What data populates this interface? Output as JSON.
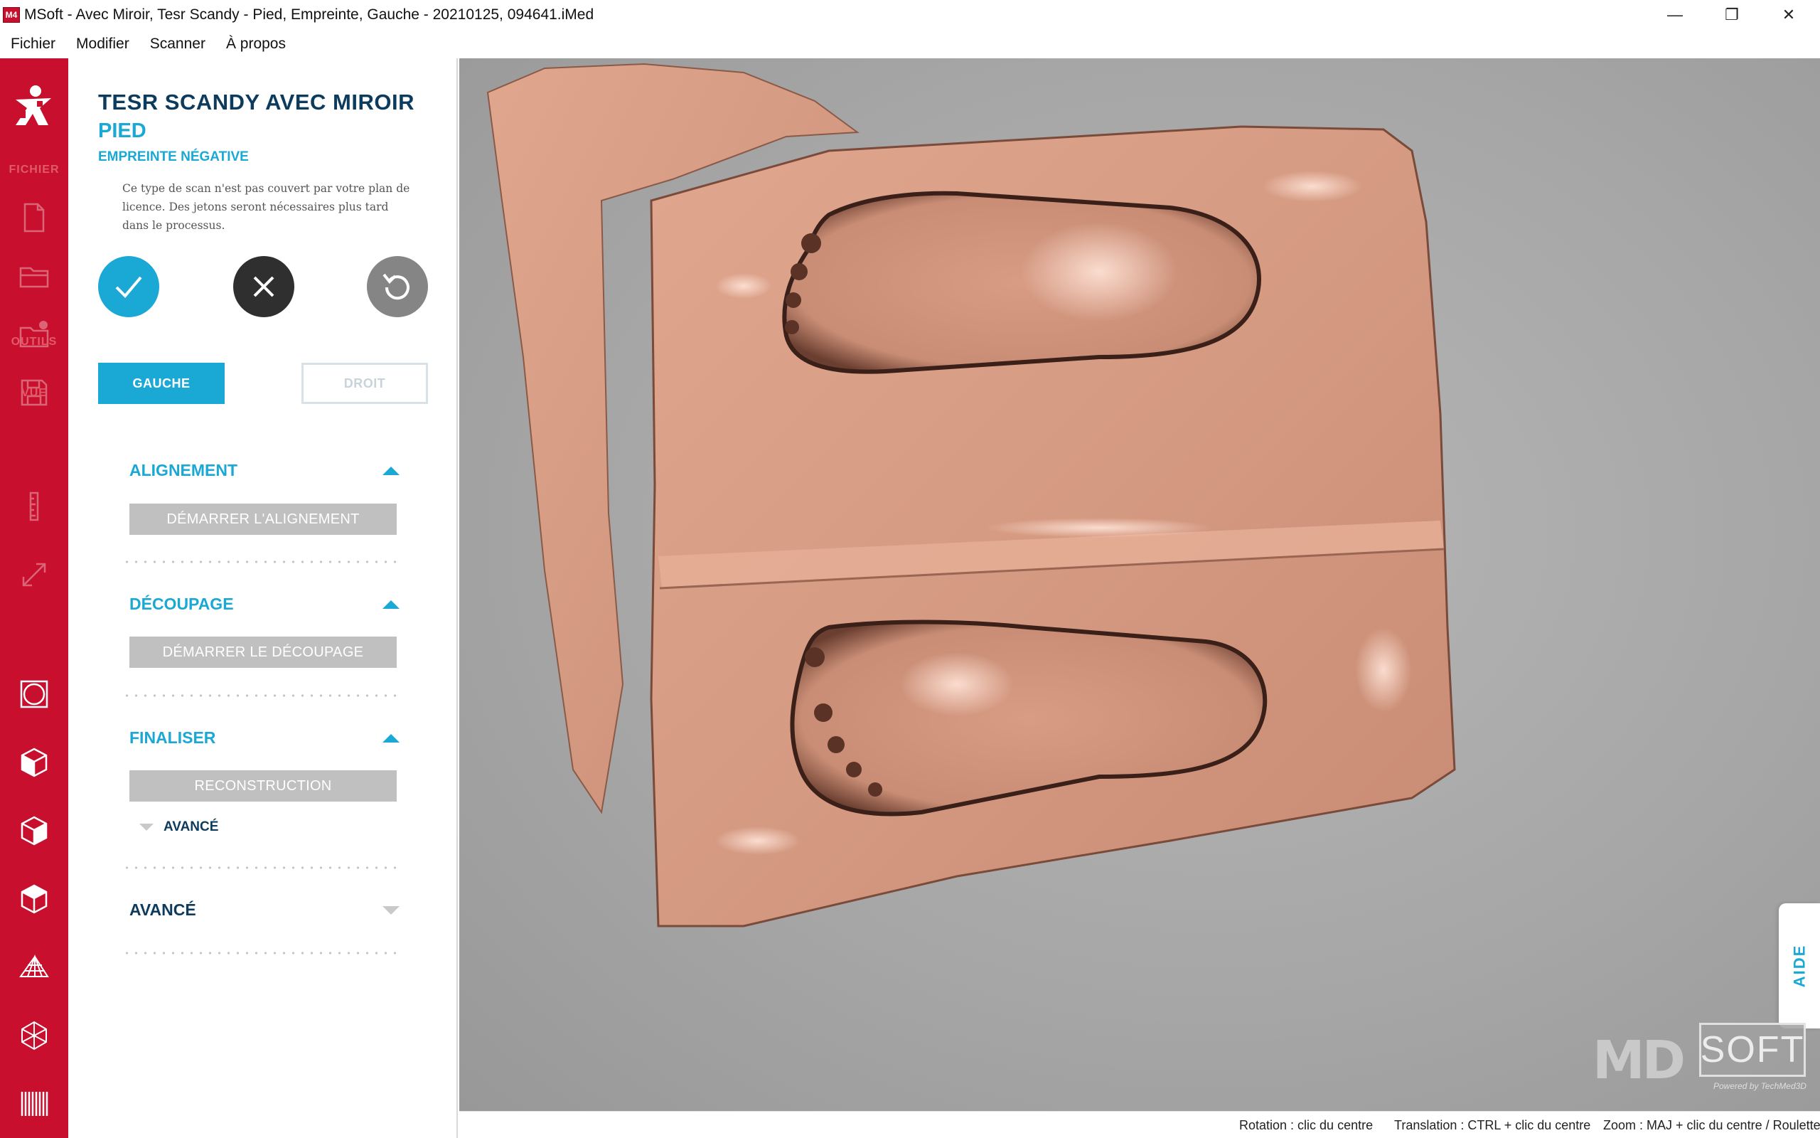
{
  "window": {
    "logo_text": "M4",
    "title": "MSoft  - Avec Miroir, Tesr Scandy - Pied, Empreinte, Gauche - 20210125, 094641.iMed",
    "minimize_glyph": "—",
    "maximize_glyph": "❐",
    "close_glyph": "✕"
  },
  "menu": {
    "items": [
      "Fichier",
      "Modifier",
      "Scanner",
      "À propos"
    ]
  },
  "toolbar": {
    "sections": {
      "file": "FICHIER",
      "tools": "OUTILS",
      "view": "VUE"
    },
    "icons": [
      "new-file-icon",
      "open-folder-icon",
      "recent-folder-icon",
      "save-icon",
      "ruler-icon",
      "resize-icon",
      "view-front-icon",
      "view-cube-left-icon",
      "view-cube-right-icon",
      "view-cube-top-icon",
      "perspective-icon",
      "wireframe-icon",
      "barcode-icon"
    ],
    "accent_color": "#c8102e"
  },
  "panel": {
    "title": "TESR SCANDY AVEC MIROIR",
    "subtitle": "PIED",
    "subtitle2": "EMPREINTE NÉGATIVE",
    "note": "Ce type de scan n'est pas couvert par votre plan de licence. Des jetons seront nécessaires plus tard dans le processus.",
    "buttons": {
      "left": "GAUCHE",
      "right": "DROIT"
    },
    "sections": {
      "alignment": {
        "title": "ALIGNEMENT",
        "button": "DÉMARRER L'ALIGNEMENT"
      },
      "cutting": {
        "title": "DÉCOUPAGE",
        "button": "DÉMARRER LE DÉCOUPAGE"
      },
      "finalize": {
        "title": "FINALISER",
        "button": "RECONSTRUCTION",
        "sub": "AVANCÉ"
      },
      "advanced": {
        "title": "AVANCÉ"
      }
    },
    "accent_color": "#1aa8d4",
    "title_color": "#0d3b5e"
  },
  "viewport": {
    "help_tab": "AIDE",
    "watermark": {
      "md": "MD",
      "soft": "SOFT",
      "powered": "Powered by TechMed3D"
    },
    "model_color": "#d59a82"
  },
  "status": {
    "rotation": "Rotation : clic du centre",
    "translation": "Translation : CTRL + clic du centre",
    "zoom": "Zoom : MAJ + clic du centre / Roulette"
  }
}
